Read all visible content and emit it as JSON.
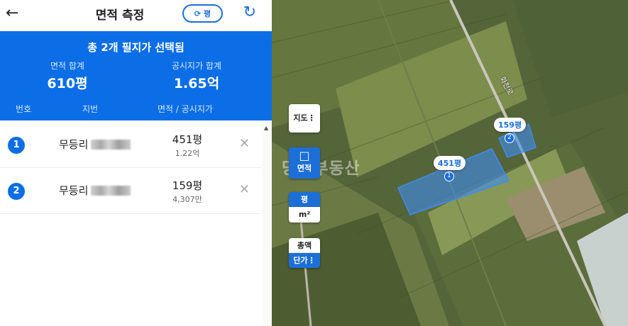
{
  "header": {
    "title": "면적 측정",
    "unit_toggle_label": "평"
  },
  "summary": {
    "title": "총 2개 필지가 선택됨",
    "area_label": "면적 합계",
    "area_value": "610평",
    "price_label": "공시지가 합계",
    "price_value": "1.65억",
    "columns": [
      "번호",
      "지번",
      "면적 / 공시지가"
    ]
  },
  "parcels": [
    {
      "num": "1",
      "jibun": "무등리",
      "area": "451평",
      "price": "1.22억"
    },
    {
      "num": "2",
      "jibun": "무등리",
      "area": "159평",
      "price": "4,307만"
    }
  ],
  "map": {
    "map_type_button": "지도",
    "measure_button": "면적",
    "unit_pyeong": "평",
    "unit_m2": "m²",
    "total_button": "총액",
    "unit_price_button": "단가",
    "watermark": "당근부동산",
    "road_label": "화천로",
    "pins": [
      {
        "label": "451평",
        "num": "1"
      },
      {
        "label": "159평",
        "num": "2"
      }
    ]
  },
  "colors": {
    "accent": "#0b6ee6",
    "parcel_fill": "#3d8cf0"
  }
}
